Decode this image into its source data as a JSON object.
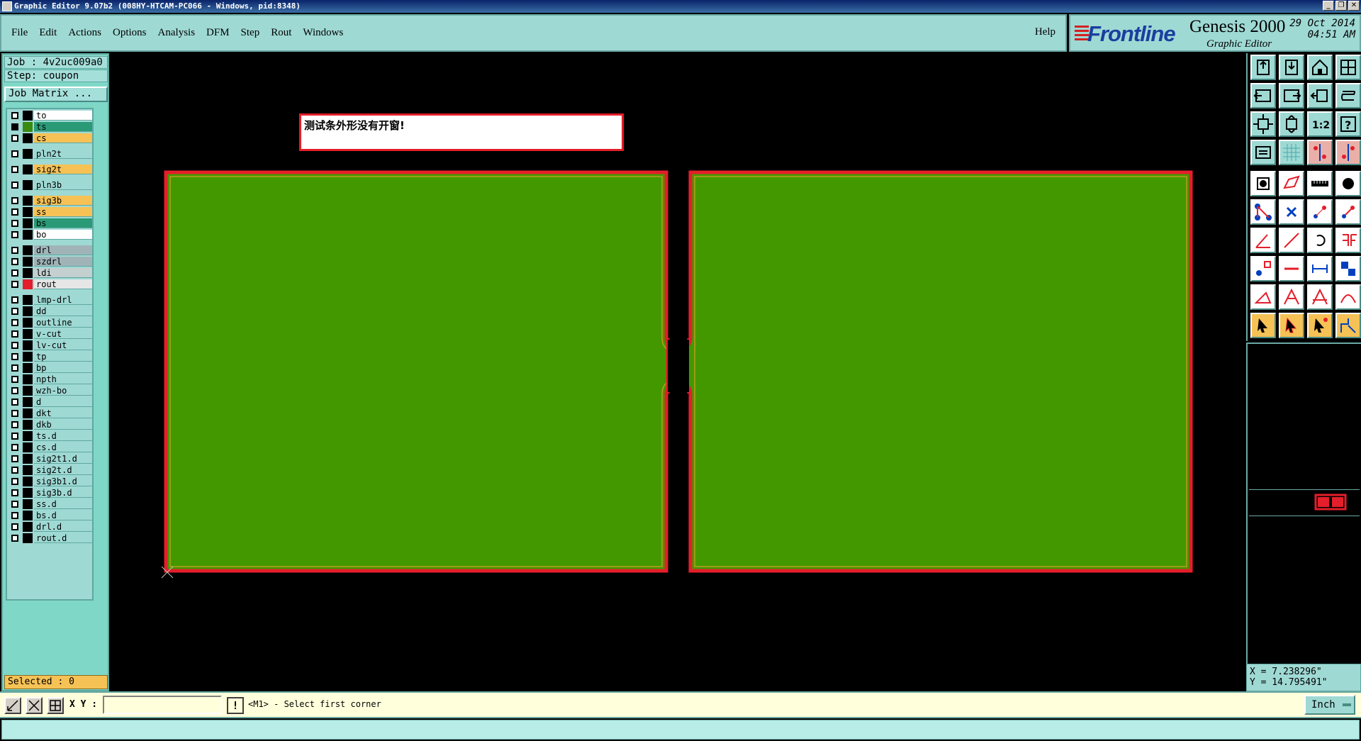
{
  "window": {
    "title": "Graphic Editor 9.07b2 (008HY-HTCAM-PC066 - Windows, pid:8348)"
  },
  "menu": {
    "items": [
      "File",
      "Edit",
      "Actions",
      "Options",
      "Analysis",
      "DFM",
      "Step",
      "Rout",
      "Windows"
    ],
    "help": "Help"
  },
  "brand": {
    "logo": "Frontline",
    "product": "Genesis 2000",
    "subtitle": "Graphic Editor",
    "date": "29 Oct 2014",
    "time": "04:51 AM"
  },
  "job": {
    "job_line": "Job : 4v2uc009a0",
    "step_line": "Step: coupon",
    "matrix_button": "Job Matrix ..."
  },
  "layers": [
    {
      "name": "to",
      "color": "#ffffff",
      "swatch": "#000000",
      "checked": false
    },
    {
      "name": "ts",
      "color": "#2a9a76",
      "swatch": "#3a8a10",
      "checked": true,
      "mark": "#4a6aaa"
    },
    {
      "name": "cs",
      "color": "#f6c256",
      "swatch": "#000000",
      "checked": false
    },
    {
      "name": "pln2t",
      "color": "#9fd9d4",
      "swatch": "#000000",
      "checked": false
    },
    {
      "name": "sig2t",
      "color": "#f6c256",
      "swatch": "#000000",
      "checked": false
    },
    {
      "name": "pln3b",
      "color": "#9fd9d4",
      "swatch": "#000000",
      "checked": false
    },
    {
      "name": "sig3b",
      "color": "#f6c256",
      "swatch": "#000000",
      "checked": false
    },
    {
      "name": "ss",
      "color": "#f6c256",
      "swatch": "#000000",
      "checked": false
    },
    {
      "name": "bs",
      "color": "#2a9a76",
      "swatch": "#000000",
      "checked": false
    },
    {
      "name": "bo",
      "color": "#ffffff",
      "swatch": "#000000",
      "checked": false
    },
    {
      "name": "drl",
      "color": "#a0b4b8",
      "swatch": "#000000",
      "checked": false
    },
    {
      "name": "szdrl",
      "color": "#a0b4b8",
      "swatch": "#000000",
      "checked": false
    },
    {
      "name": "ldi",
      "color": "#c4cfd0",
      "swatch": "#000000",
      "checked": false
    },
    {
      "name": "rout",
      "color": "#e6e6e6",
      "swatch": "#e41e2a",
      "checked": false
    },
    {
      "name": "lmp-drl",
      "color": "#9fd9d4",
      "swatch": "#000000",
      "checked": false
    },
    {
      "name": "dd",
      "color": "#9fd9d4",
      "swatch": "#000000",
      "checked": false
    },
    {
      "name": "outline",
      "color": "#9fd9d4",
      "swatch": "#000000",
      "checked": false
    },
    {
      "name": "v-cut",
      "color": "#9fd9d4",
      "swatch": "#000000",
      "checked": false
    },
    {
      "name": "lv-cut",
      "color": "#9fd9d4",
      "swatch": "#000000",
      "checked": false
    },
    {
      "name": "tp",
      "color": "#9fd9d4",
      "swatch": "#000000",
      "checked": false
    },
    {
      "name": "bp",
      "color": "#9fd9d4",
      "swatch": "#000000",
      "checked": false
    },
    {
      "name": "npth",
      "color": "#9fd9d4",
      "swatch": "#000000",
      "checked": false
    },
    {
      "name": "wzh-bo",
      "color": "#9fd9d4",
      "swatch": "#000000",
      "checked": false
    },
    {
      "name": "d",
      "color": "#9fd9d4",
      "swatch": "#000000",
      "checked": false
    },
    {
      "name": "dkt",
      "color": "#9fd9d4",
      "swatch": "#000000",
      "checked": false
    },
    {
      "name": "dkb",
      "color": "#9fd9d4",
      "swatch": "#000000",
      "checked": false
    },
    {
      "name": "ts.d",
      "color": "#9fd9d4",
      "swatch": "#000000",
      "checked": false
    },
    {
      "name": "cs.d",
      "color": "#9fd9d4",
      "swatch": "#000000",
      "checked": false
    },
    {
      "name": "sig2t1.d",
      "color": "#9fd9d4",
      "swatch": "#000000",
      "checked": false
    },
    {
      "name": "sig2t.d",
      "color": "#9fd9d4",
      "swatch": "#000000",
      "checked": false
    },
    {
      "name": "sig3b1.d",
      "color": "#9fd9d4",
      "swatch": "#000000",
      "checked": false
    },
    {
      "name": "sig3b.d",
      "color": "#9fd9d4",
      "swatch": "#000000",
      "checked": false
    },
    {
      "name": "ss.d",
      "color": "#9fd9d4",
      "swatch": "#000000",
      "checked": false
    },
    {
      "name": "bs.d",
      "color": "#9fd9d4",
      "swatch": "#000000",
      "checked": false
    },
    {
      "name": "drl.d",
      "color": "#9fd9d4",
      "swatch": "#000000",
      "checked": false
    },
    {
      "name": "rout.d",
      "color": "#9fd9d4",
      "swatch": "#000000",
      "checked": false
    }
  ],
  "selected": "Selected : 0",
  "canvas": {
    "message": "测试条外形没有开窗!",
    "board_color": "#439800",
    "outline_color": "#e41e2a"
  },
  "toolbar": {
    "icons": [
      "open-icon",
      "save-icon",
      "home-icon",
      "split-view-icon",
      "pan-left-icon",
      "pan-right-icon",
      "pan-up-icon",
      "pan-down-icon",
      "zoom-fit-icon",
      "zoom-home-icon",
      "scale-1to2-icon",
      "help-query-icon",
      "snap-icon",
      "grid-icon",
      "layer-compare-icon",
      "layer-measure-icon",
      "pad-add-icon",
      "select-rect-icon",
      "measure-icon",
      "circle-icon",
      "connect-icon",
      "delete-icon",
      "move-icon",
      "copy-icon",
      "line-angle-icon",
      "line-icon",
      "arc-icon",
      "flip-icon",
      "resize-icon",
      "cut-line-icon",
      "dimension-icon",
      "net-icon",
      "slope-icon",
      "arrow-up-icon",
      "arch-icon",
      "arc-up-icon",
      "pointer-icon",
      "pointer-box-icon",
      "pointer-net-icon",
      "route-icon"
    ]
  },
  "coords": {
    "x": "X = 7.238296\"",
    "y": "Y = 14.795491\""
  },
  "bottom": {
    "xy_label": "X Y :",
    "xy_value": "",
    "prompt": "<M1> - Select first corner",
    "unit": "Inch"
  }
}
